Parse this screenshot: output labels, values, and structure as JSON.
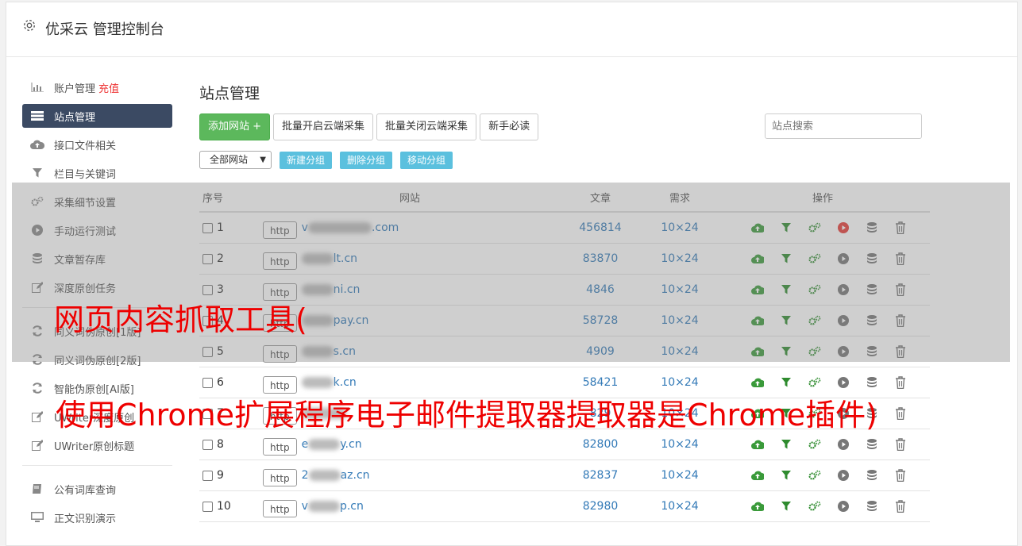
{
  "app_title": "优采云 管理控制台",
  "sidebar": {
    "items": [
      {
        "label": "账户管理",
        "badge": "充值",
        "icon": "bar-chart-icon"
      },
      {
        "label": "站点管理",
        "icon": "list-icon",
        "active": true
      },
      {
        "label": "接口文件相关",
        "icon": "cloud-upload-icon"
      },
      {
        "label": "栏目与关键词",
        "icon": "filter-icon"
      },
      {
        "label": "采集细节设置",
        "icon": "gears-icon"
      },
      {
        "label": "手动运行测试",
        "icon": "play-icon"
      },
      {
        "label": "文章暂存库",
        "icon": "database-icon"
      },
      {
        "label": "深度原创任务",
        "icon": "edit-icon"
      }
    ],
    "items2": [
      {
        "label": "同义词伪原创[1版]",
        "icon": "refresh-icon"
      },
      {
        "label": "同义词伪原创[2版]",
        "icon": "refresh-icon"
      },
      {
        "label": "智能伪原创[AI版]",
        "icon": "refresh-icon"
      },
      {
        "label": "UWriter深度原创",
        "icon": "edit-icon"
      },
      {
        "label": "UWriter原创标题",
        "icon": "edit-icon"
      }
    ],
    "items3": [
      {
        "label": "公有词库查询",
        "icon": "book-icon"
      },
      {
        "label": "正文识别演示",
        "icon": "monitor-icon"
      }
    ]
  },
  "main": {
    "title": "站点管理",
    "buttons": {
      "add": "添加网站 +",
      "batch_on": "批量开启云端采集",
      "batch_off": "批量关闭云端采集",
      "guide": "新手必读"
    },
    "search_placeholder": "站点搜索",
    "group_select": "全部网站",
    "group_buttons": {
      "new": "新建分组",
      "delete": "删除分组",
      "move": "移动分组"
    },
    "table": {
      "headers": {
        "no": "序号",
        "site": "网站",
        "articles": "文章",
        "demand": "需求",
        "ops": "操作"
      },
      "http_label": "http",
      "rows": [
        {
          "no": "1",
          "site": "v  .com",
          "articles": "456814",
          "demand": "10×24",
          "running": true
        },
        {
          "no": "2",
          "site": "  lt.cn",
          "articles": "83870",
          "demand": "10×24"
        },
        {
          "no": "3",
          "site": "  ni.cn",
          "articles": "4846",
          "demand": "10×24"
        },
        {
          "no": "4",
          "site": "  pay.cn",
          "articles": "58728",
          "demand": "10×24"
        },
        {
          "no": "5",
          "site": "  s.cn",
          "articles": "4909",
          "demand": "10×24"
        },
        {
          "no": "6",
          "site": "  k.cn",
          "articles": "58421",
          "demand": "10×24"
        },
        {
          "no": "7",
          "site": "  ",
          "articles": "829",
          "demand": "10×24"
        },
        {
          "no": "8",
          "site": "e  y.cn",
          "articles": "82800",
          "demand": "10×24"
        },
        {
          "no": "9",
          "site": "2  az.cn",
          "articles": "82837",
          "demand": "10×24"
        },
        {
          "no": "10",
          "site": "v  p.cn",
          "articles": "82980",
          "demand": "10×24"
        }
      ]
    }
  },
  "overlay": {
    "line1": "网页内容抓取工具(",
    "line2": "使用Chrome扩展程序电子邮件提取器提取器是Chrome插件)"
  },
  "colors": {
    "accent_green": "#5cb85c",
    "info_blue": "#5bc0de",
    "active_nav": "#3b4a63",
    "overlay_red": "#e00000"
  }
}
